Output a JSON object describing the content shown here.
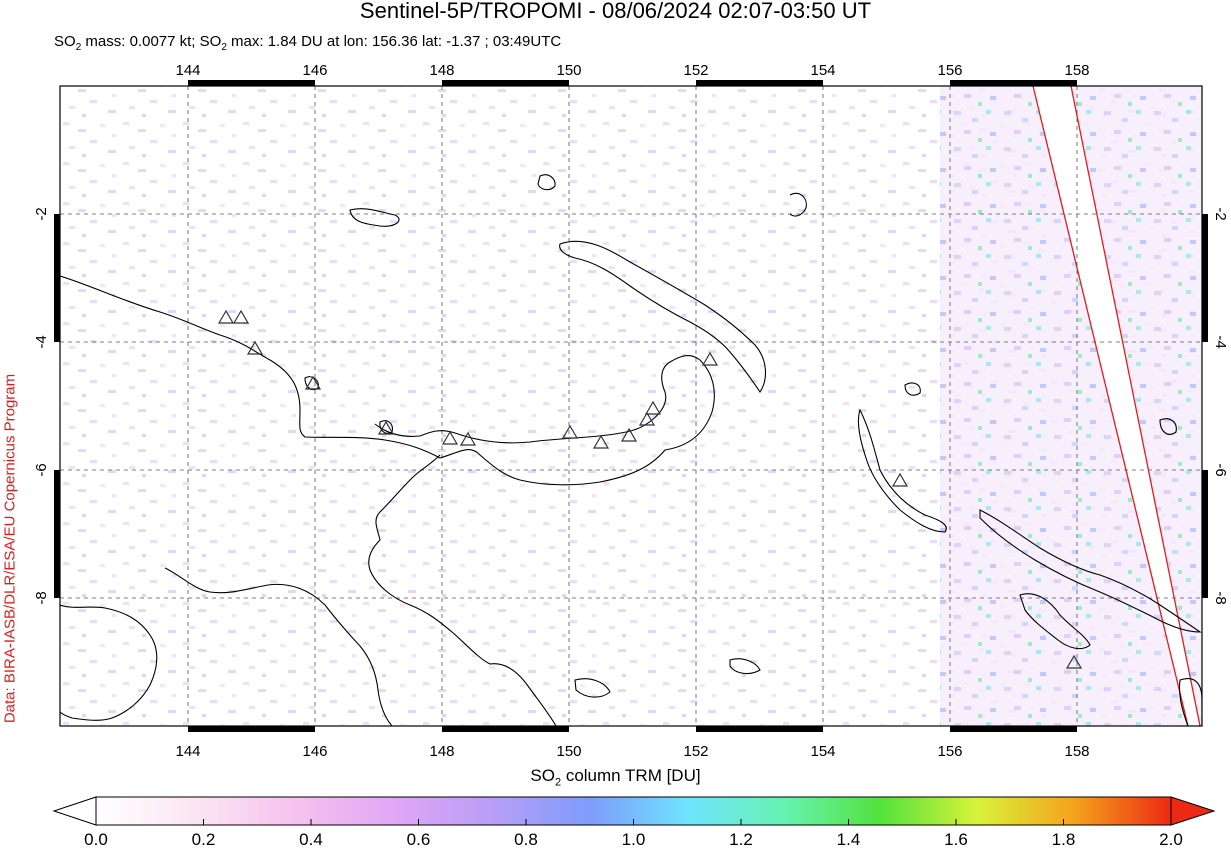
{
  "title": "Sentinel-5P/TROPOMI - 08/06/2024 02:07-03:50 UT",
  "subtitle_parts": {
    "so2_mass_prefix": "SO",
    "so2_mass_suffix": " mass: 0.0077 kt; SO",
    "so2_max_suffix": " max: 1.84 DU at lon: 156.36 lat: -1.37 ; 03:49UTC",
    "subscript": "2"
  },
  "credit": "Data: BIRA-IASB/DLR/ESA/EU Copernicus Program",
  "map": {
    "lon_range": [
      142.0,
      160.0
    ],
    "lat_range": [
      -10.0,
      0.0
    ],
    "lon_ticks": [
      "144",
      "146",
      "148",
      "150",
      "152",
      "154",
      "156",
      "158"
    ],
    "lat_ticks": [
      "-2",
      "-4",
      "-6",
      "-8"
    ],
    "volcano_marker": "triangle-icon",
    "swath_edge_color": "#e21b1b",
    "coastline_color": "#000000"
  },
  "colorbar": {
    "label_prefix": "SO",
    "label_sub": "2",
    "label_suffix": " column TRM [DU]",
    "ticks": [
      "0.0",
      "0.2",
      "0.4",
      "0.6",
      "0.8",
      "1.0",
      "1.2",
      "1.4",
      "1.6",
      "1.8",
      "2.0"
    ],
    "range": [
      0.0,
      2.0
    ],
    "colors": [
      "#ffffff",
      "#fbd3f0",
      "#e7a3f4",
      "#b79ef7",
      "#7f9cfa",
      "#6fe3ff",
      "#67f2b2",
      "#53e23c",
      "#c9f23a",
      "#f9d92c",
      "#f59318",
      "#ec2a14"
    ]
  }
}
